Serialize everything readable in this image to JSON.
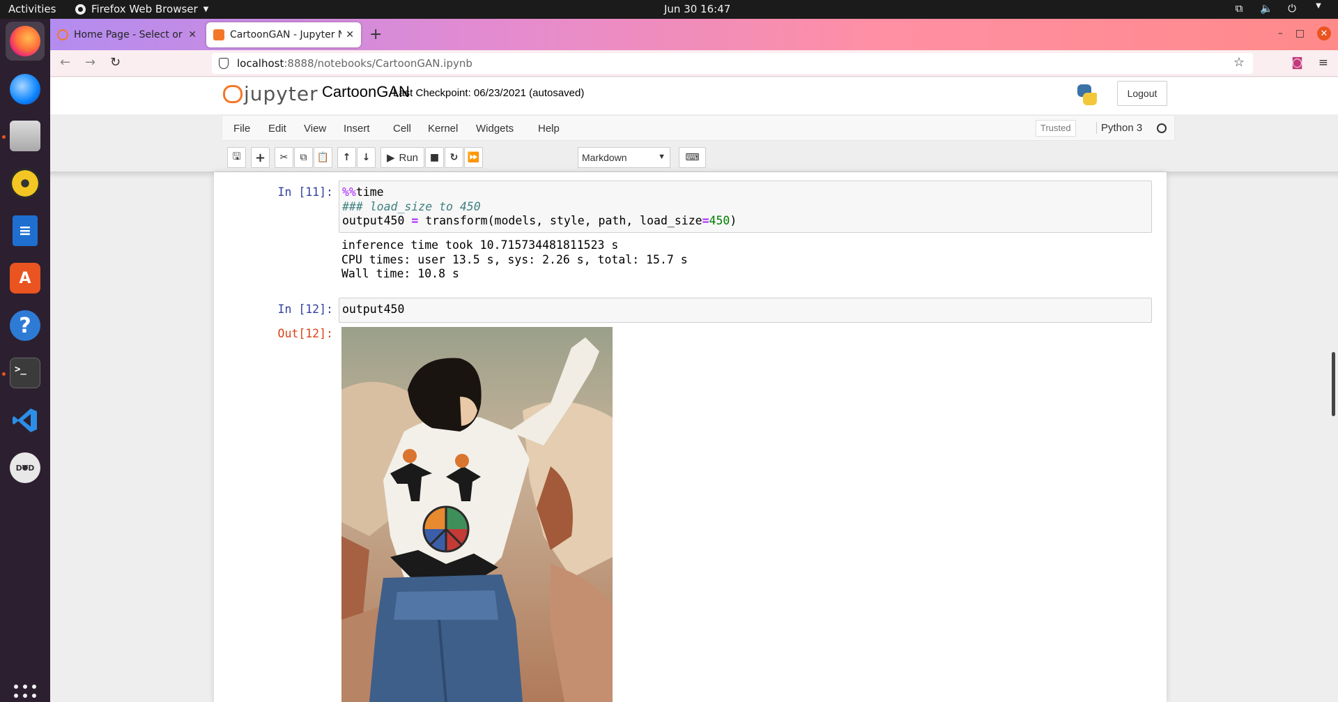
{
  "topbar": {
    "activities": "Activities",
    "app_name": "Firefox Web Browser",
    "clock": "Jun 30  16:47",
    "icons": [
      "network-icon",
      "volume-icon",
      "power-icon",
      "menu-caret-icon"
    ]
  },
  "dock": {
    "items": [
      "firefox",
      "thunderbird",
      "files",
      "rhythmbox",
      "libreoffice-writer",
      "ubuntu-software",
      "help",
      "terminal",
      "vscode",
      "dvd"
    ],
    "dvd_label": "DVD",
    "terminal_prompt": ">_"
  },
  "browser": {
    "tabs": [
      {
        "title": "Home Page - Select or create a notebook"
      },
      {
        "title": "CartoonGAN - Jupyter Notebook"
      }
    ],
    "new_tab": "+",
    "url_host": "localhost",
    "url_path": ":8888/notebooks/CartoonGAN.ipynb",
    "window_controls": {
      "minimize": "–",
      "maximize": "□",
      "close": "✕"
    }
  },
  "jupyter": {
    "logo_word": "jupyter",
    "notebook_name": "CartoonGAN",
    "checkpoint": "Last Checkpoint: 06/23/2021   (autosaved)",
    "logout": "Logout",
    "menu": [
      "File",
      "Edit",
      "View",
      "Insert",
      "Cell",
      "Kernel",
      "Widgets",
      "Help"
    ],
    "trusted": "Trusted",
    "kernel": "Python 3",
    "toolbar": {
      "run_label": "Run",
      "cell_type": "Markdown"
    }
  },
  "cells": [
    {
      "prompt": "In [11]:",
      "code_magic": "%%",
      "code_magic_rest": "time",
      "code_comment": "### load_size to 450",
      "code_line3_a": "output450 ",
      "code_line3_eq": "=",
      "code_line3_b": " transform(models, style, path, load_size",
      "code_line3_eq2": "=",
      "code_line3_num": "450",
      "code_line3_end": ")",
      "output": [
        "inference time took 10.715734481811523 s",
        "CPU times: user 13.5 s, sys: 2.26 s, total: 15.7 s",
        "Wall time: 10.8 s"
      ]
    },
    {
      "prompt": "In [12]:",
      "code": "output450",
      "out_prompt": "Out[12]:"
    }
  ],
  "colors": {
    "jupyter_orange": "#f37726",
    "in_prompt": "#303f9f",
    "out_prompt": "#d84315",
    "ubuntu_orange": "#e95420"
  }
}
